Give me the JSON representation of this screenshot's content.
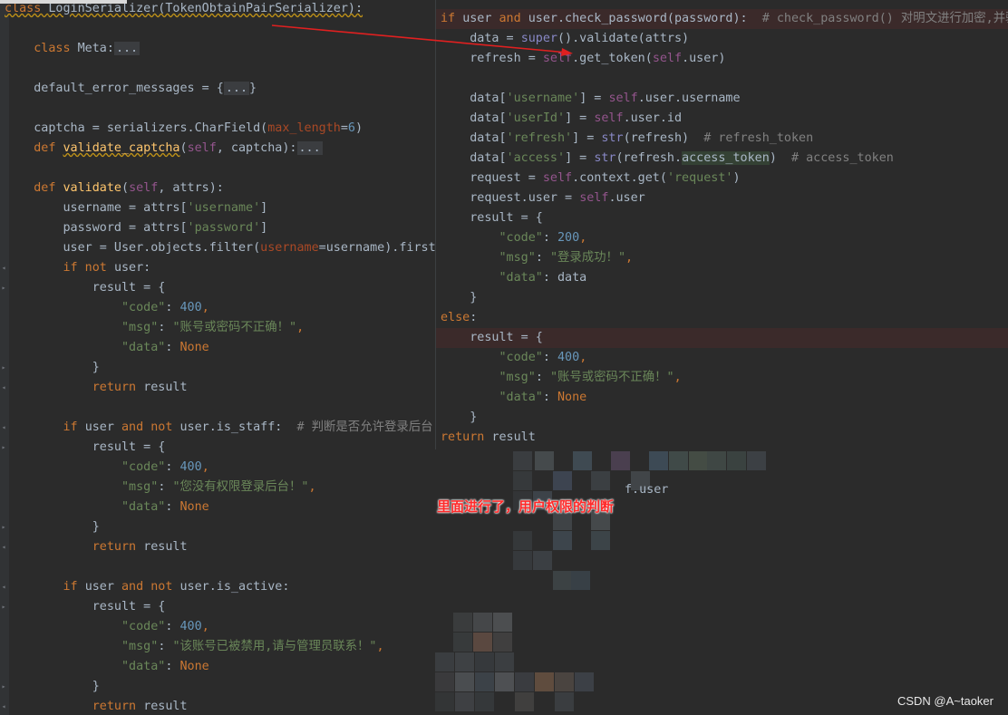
{
  "editor": {
    "lines": [
      [
        [
          "kw",
          "class "
        ],
        [
          "",
          "LoginSerializer(TokenObtainPairSerializer):"
        ]
      ],
      [],
      [
        [
          "",
          "    "
        ],
        [
          "kw",
          "class "
        ],
        [
          "",
          "Meta:"
        ],
        [
          "fold",
          "..."
        ]
      ],
      [],
      [
        [
          "",
          "    default_error_messages = {"
        ],
        [
          "fold",
          "..."
        ],
        [
          "",
          "}"
        ]
      ],
      [],
      [
        [
          "",
          "    captcha = serializers.CharField("
        ],
        [
          "param",
          "max_length"
        ],
        [
          "",
          "="
        ],
        [
          "num",
          "6"
        ],
        [
          "",
          ")"
        ]
      ],
      [
        [
          "",
          "    "
        ],
        [
          "kw",
          "def "
        ],
        [
          "fn",
          "validate_captcha"
        ],
        [
          "",
          "("
        ],
        [
          "self",
          "self"
        ],
        [
          "",
          ", captcha):"
        ],
        [
          "fold",
          "..."
        ]
      ],
      [],
      [
        [
          "",
          "    "
        ],
        [
          "kw",
          "def "
        ],
        [
          "fn",
          "validate"
        ],
        [
          "",
          "("
        ],
        [
          "self",
          "self"
        ],
        [
          "",
          ", attrs):"
        ]
      ],
      [
        [
          "",
          "        username = attrs["
        ],
        [
          "str",
          "'username'"
        ],
        [
          "",
          "]"
        ]
      ],
      [
        [
          "",
          "        password = attrs["
        ],
        [
          "str",
          "'password'"
        ],
        [
          "",
          "]"
        ]
      ],
      [
        [
          "",
          "        user = User.objects.filter("
        ],
        [
          "param",
          "username"
        ],
        [
          "",
          "=username).first"
        ]
      ],
      [
        [
          "",
          "        "
        ],
        [
          "kw",
          "if not "
        ],
        [
          "",
          "user:"
        ]
      ],
      [
        [
          "",
          "            result = {"
        ]
      ],
      [
        [
          "",
          "                "
        ],
        [
          "str",
          "\"code\""
        ],
        [
          "",
          ": "
        ],
        [
          "num",
          "400"
        ],
        [
          "kw",
          ","
        ]
      ],
      [
        [
          "",
          "                "
        ],
        [
          "str",
          "\"msg\""
        ],
        [
          "",
          ": "
        ],
        [
          "str",
          "\"账号或密码不正确！\""
        ],
        [
          "kw",
          ","
        ]
      ],
      [
        [
          "",
          "                "
        ],
        [
          "str",
          "\"data\""
        ],
        [
          "",
          ": "
        ],
        [
          "kw",
          "None"
        ]
      ],
      [
        [
          "",
          "            }"
        ]
      ],
      [
        [
          "",
          "            "
        ],
        [
          "kw",
          "return "
        ],
        [
          "",
          "result"
        ]
      ],
      [],
      [
        [
          "",
          "        "
        ],
        [
          "kw",
          "if "
        ],
        [
          "",
          "user "
        ],
        [
          "kw",
          "and not "
        ],
        [
          "",
          "user.is_staff:  "
        ],
        [
          "cmt",
          "# 判断是否允许登录后台"
        ]
      ],
      [
        [
          "",
          "            result = {"
        ]
      ],
      [
        [
          "",
          "                "
        ],
        [
          "str",
          "\"code\""
        ],
        [
          "",
          ": "
        ],
        [
          "num",
          "400"
        ],
        [
          "kw",
          ","
        ]
      ],
      [
        [
          "",
          "                "
        ],
        [
          "str",
          "\"msg\""
        ],
        [
          "",
          ": "
        ],
        [
          "str",
          "\"您没有权限登录后台！\""
        ],
        [
          "kw",
          ","
        ]
      ],
      [
        [
          "",
          "                "
        ],
        [
          "str",
          "\"data\""
        ],
        [
          "",
          ": "
        ],
        [
          "kw",
          "None"
        ]
      ],
      [
        [
          "",
          "            }"
        ]
      ],
      [
        [
          "",
          "            "
        ],
        [
          "kw",
          "return "
        ],
        [
          "",
          "result"
        ]
      ],
      [],
      [
        [
          "",
          "        "
        ],
        [
          "kw",
          "if "
        ],
        [
          "",
          "user "
        ],
        [
          "kw",
          "and not "
        ],
        [
          "",
          "user.is_active:"
        ]
      ],
      [
        [
          "",
          "            result = {"
        ]
      ],
      [
        [
          "",
          "                "
        ],
        [
          "str",
          "\"code\""
        ],
        [
          "",
          ": "
        ],
        [
          "num",
          "400"
        ],
        [
          "kw",
          ","
        ]
      ],
      [
        [
          "",
          "                "
        ],
        [
          "str",
          "\"msg\""
        ],
        [
          "",
          ": "
        ],
        [
          "str",
          "\"该账号已被禁用,请与管理员联系！\""
        ],
        [
          "kw",
          ","
        ]
      ],
      [
        [
          "",
          "                "
        ],
        [
          "str",
          "\"data\""
        ],
        [
          "",
          ": "
        ],
        [
          "kw",
          "None"
        ]
      ],
      [
        [
          "",
          "            }"
        ]
      ],
      [
        [
          "",
          "            "
        ],
        [
          "kw",
          "return "
        ],
        [
          "",
          "result"
        ]
      ]
    ]
  },
  "popup": {
    "lines": [
      [
        [
          "kw",
          "if "
        ],
        [
          "",
          "user "
        ],
        [
          "kw",
          "and "
        ],
        [
          "",
          "user.check_password(password):  "
        ],
        [
          "cmt",
          "# check_password() 对明文进行加密,并验"
        ]
      ],
      [
        [
          "",
          "    data = "
        ],
        [
          "bi",
          "super"
        ],
        [
          "",
          "().validate(attrs)"
        ]
      ],
      [
        [
          "",
          "    refresh = "
        ],
        [
          "self",
          "self"
        ],
        [
          "",
          ".get_token("
        ],
        [
          "self",
          "self"
        ],
        [
          "",
          ".user)"
        ]
      ],
      [],
      [
        [
          "",
          "    data["
        ],
        [
          "str",
          "'username'"
        ],
        [
          "",
          "] = "
        ],
        [
          "self",
          "self"
        ],
        [
          "",
          ".user.username"
        ]
      ],
      [
        [
          "",
          "    data["
        ],
        [
          "str",
          "'userId'"
        ],
        [
          "",
          "] = "
        ],
        [
          "self",
          "self"
        ],
        [
          "",
          ".user.id"
        ]
      ],
      [
        [
          "",
          "    data["
        ],
        [
          "str",
          "'refresh'"
        ],
        [
          "",
          "] = "
        ],
        [
          "bi",
          "str"
        ],
        [
          "",
          "(refresh)  "
        ],
        [
          "cmt",
          "# refresh_token"
        ]
      ],
      [
        [
          "",
          "    data["
        ],
        [
          "str",
          "'access'"
        ],
        [
          "",
          "] = "
        ],
        [
          "bi",
          "str"
        ],
        [
          "",
          "(refresh."
        ],
        [
          "usage",
          "access_token"
        ],
        [
          "",
          ")  "
        ],
        [
          "cmt",
          "# access_token"
        ]
      ],
      [
        [
          "",
          "    request = "
        ],
        [
          "self",
          "self"
        ],
        [
          "",
          ".context.get("
        ],
        [
          "str",
          "'request'"
        ],
        [
          "",
          ")"
        ]
      ],
      [
        [
          "",
          "    request.user = "
        ],
        [
          "self",
          "self"
        ],
        [
          "",
          ".user"
        ]
      ],
      [
        [
          "",
          "    result = {"
        ]
      ],
      [
        [
          "",
          "        "
        ],
        [
          "str",
          "\"code\""
        ],
        [
          "",
          ": "
        ],
        [
          "num",
          "200"
        ],
        [
          "kw",
          ","
        ]
      ],
      [
        [
          "",
          "        "
        ],
        [
          "str",
          "\"msg\""
        ],
        [
          "",
          ": "
        ],
        [
          "str",
          "\"登录成功！\""
        ],
        [
          "kw",
          ","
        ]
      ],
      [
        [
          "",
          "        "
        ],
        [
          "str",
          "\"data\""
        ],
        [
          "",
          ": data"
        ]
      ],
      [
        [
          "",
          "    }"
        ]
      ],
      [
        [
          "kw",
          "else"
        ],
        [
          "",
          ":"
        ]
      ],
      [
        [
          "",
          "    result = {"
        ]
      ],
      [
        [
          "",
          "        "
        ],
        [
          "str",
          "\"code\""
        ],
        [
          "",
          ": "
        ],
        [
          "num",
          "400"
        ],
        [
          "kw",
          ","
        ]
      ],
      [
        [
          "",
          "        "
        ],
        [
          "str",
          "\"msg\""
        ],
        [
          "",
          ": "
        ],
        [
          "str",
          "\"账号或密码不正确！\""
        ],
        [
          "kw",
          ","
        ]
      ],
      [
        [
          "",
          "        "
        ],
        [
          "str",
          "\"data\""
        ],
        [
          "",
          ": "
        ],
        [
          "kw",
          "None"
        ]
      ],
      [
        [
          "",
          "    }"
        ]
      ],
      [
        [
          "kw",
          "return "
        ],
        [
          "",
          "result"
        ]
      ]
    ]
  },
  "fragment": "f.user",
  "annotation": "里面进行了，用户权限的判断",
  "watermark": "CSDN @A~taoker",
  "colors": {
    "editor_bg": "#2b2b2b",
    "keyword": "#cc7832",
    "string": "#6a8759",
    "number": "#6897bb",
    "comment": "#808080",
    "self": "#94558d",
    "function": "#ffc66d",
    "annotation": "#ff2a2a",
    "arrow": "#e02020"
  }
}
